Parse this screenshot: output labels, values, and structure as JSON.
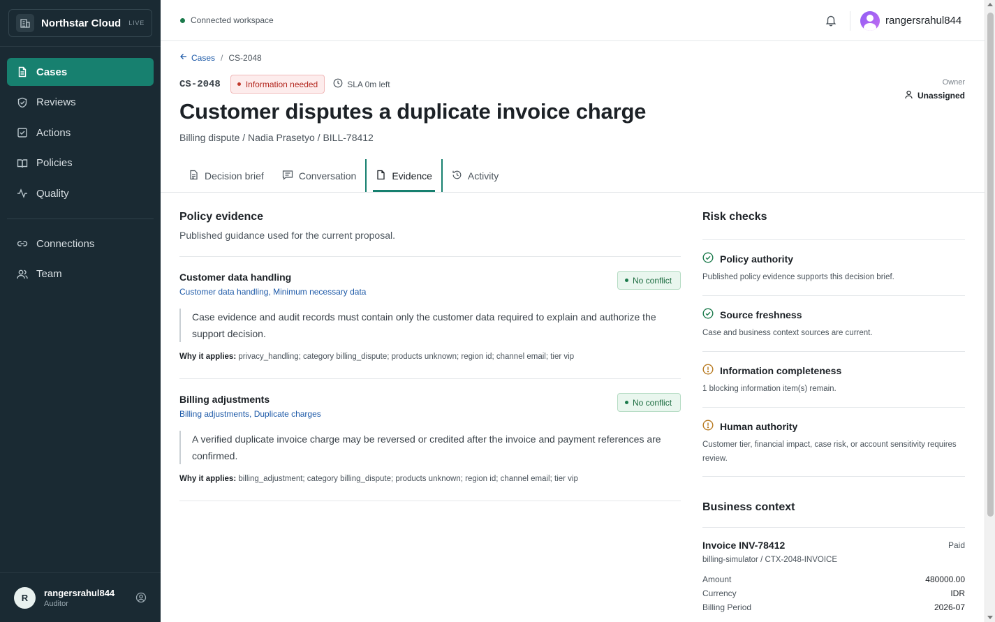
{
  "app": {
    "name": "Northstar Cloud",
    "badge": "LIVE"
  },
  "sidebar": {
    "items": [
      {
        "label": "Cases",
        "icon": "file-text-icon",
        "active": true
      },
      {
        "label": "Reviews",
        "icon": "shield-check-icon"
      },
      {
        "label": "Actions",
        "icon": "check-square-icon"
      },
      {
        "label": "Policies",
        "icon": "book-open-icon"
      },
      {
        "label": "Quality",
        "icon": "activity-icon"
      }
    ],
    "secondary": [
      {
        "label": "Connections",
        "icon": "link-icon"
      },
      {
        "label": "Team",
        "icon": "users-icon"
      }
    ],
    "user": {
      "initial": "R",
      "name": "rangersrahul844",
      "role": "Auditor"
    }
  },
  "topbar": {
    "workspace_status": "Connected workspace",
    "username": "rangersrahul844"
  },
  "breadcrumb": {
    "parent": "Cases",
    "separator": "/",
    "current": "CS-2048"
  },
  "case": {
    "id": "CS-2048",
    "status": "Information needed",
    "sla": "SLA 0m left",
    "owner_label": "Owner",
    "owner_value": "Unassigned",
    "title": "Customer disputes a duplicate invoice charge",
    "subtitle": "Billing dispute / Nadia Prasetyo / BILL-78412"
  },
  "tabs": [
    {
      "label": "Decision brief",
      "icon": "document-icon"
    },
    {
      "label": "Conversation",
      "icon": "message-icon"
    },
    {
      "label": "Evidence",
      "icon": "file-icon",
      "active": true
    },
    {
      "label": "Activity",
      "icon": "history-icon"
    }
  ],
  "policy_evidence": {
    "title": "Policy evidence",
    "subtitle": "Published guidance used for the current proposal.",
    "why_label": "Why it applies:",
    "policies": [
      {
        "name": "Customer data handling",
        "tags": "Customer data handling, Minimum necessary data",
        "badge": "No conflict",
        "text": "Case evidence and audit records must contain only the customer data required to explain and authorize the support decision.",
        "why": "privacy_handling; category billing_dispute; products unknown; region id; channel email; tier vip"
      },
      {
        "name": "Billing adjustments",
        "tags": "Billing adjustments, Duplicate charges",
        "badge": "No conflict",
        "text": "A verified duplicate invoice charge may be reversed or credited after the invoice and payment references are confirmed.",
        "why": "billing_adjustment; category billing_dispute; products unknown; region id; channel email; tier vip"
      }
    ]
  },
  "risk_checks": {
    "title": "Risk checks",
    "items": [
      {
        "name": "Policy authority",
        "status": "pass",
        "desc": "Published policy evidence supports this decision brief."
      },
      {
        "name": "Source freshness",
        "status": "pass",
        "desc": "Case and business context sources are current."
      },
      {
        "name": "Information completeness",
        "status": "warn",
        "desc": "1 blocking information item(s) remain."
      },
      {
        "name": "Human authority",
        "status": "warn",
        "desc": "Customer tier, financial impact, case risk, or account sensitivity requires review."
      }
    ]
  },
  "business_context": {
    "title": "Business context",
    "invoice_title": "Invoice INV-78412",
    "invoice_status": "Paid",
    "source": "billing-simulator / CTX-2048-INVOICE",
    "fields": [
      {
        "key": "Amount",
        "value": "480000.00"
      },
      {
        "key": "Currency",
        "value": "IDR"
      },
      {
        "key": "Billing Period",
        "value": "2026-07"
      }
    ]
  },
  "colors": {
    "sidebar_bg": "#1a2a33",
    "accent": "#17806f",
    "link": "#1e5aa8",
    "danger": "#b3261e",
    "success": "#1b7a4b",
    "warning": "#b7791f"
  }
}
